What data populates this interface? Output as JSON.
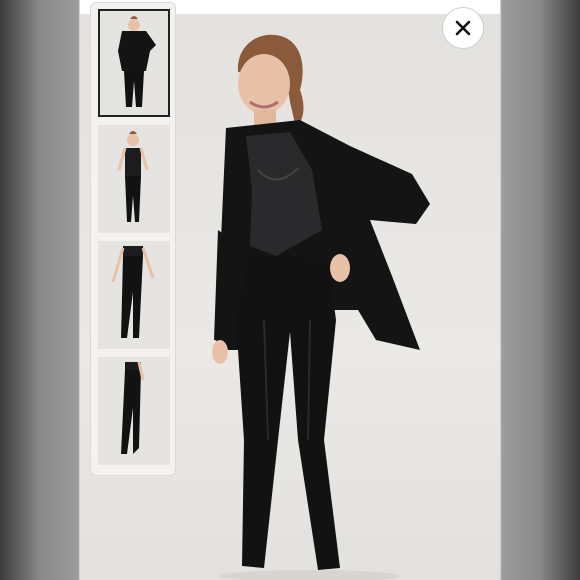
{
  "viewer": {
    "close_icon": "close-icon",
    "thumbnails": [
      {
        "name": "thumb-blazer-front",
        "selected": true
      },
      {
        "name": "thumb-bodysuit-front",
        "selected": false
      },
      {
        "name": "thumb-leggings-front",
        "selected": false
      },
      {
        "name": "thumb-leggings-side",
        "selected": false
      }
    ],
    "colors": {
      "backdrop": "#e9e7e4",
      "garment": "#111111",
      "skin": "#e8c1a7",
      "hair": "#8a5a3a"
    }
  }
}
